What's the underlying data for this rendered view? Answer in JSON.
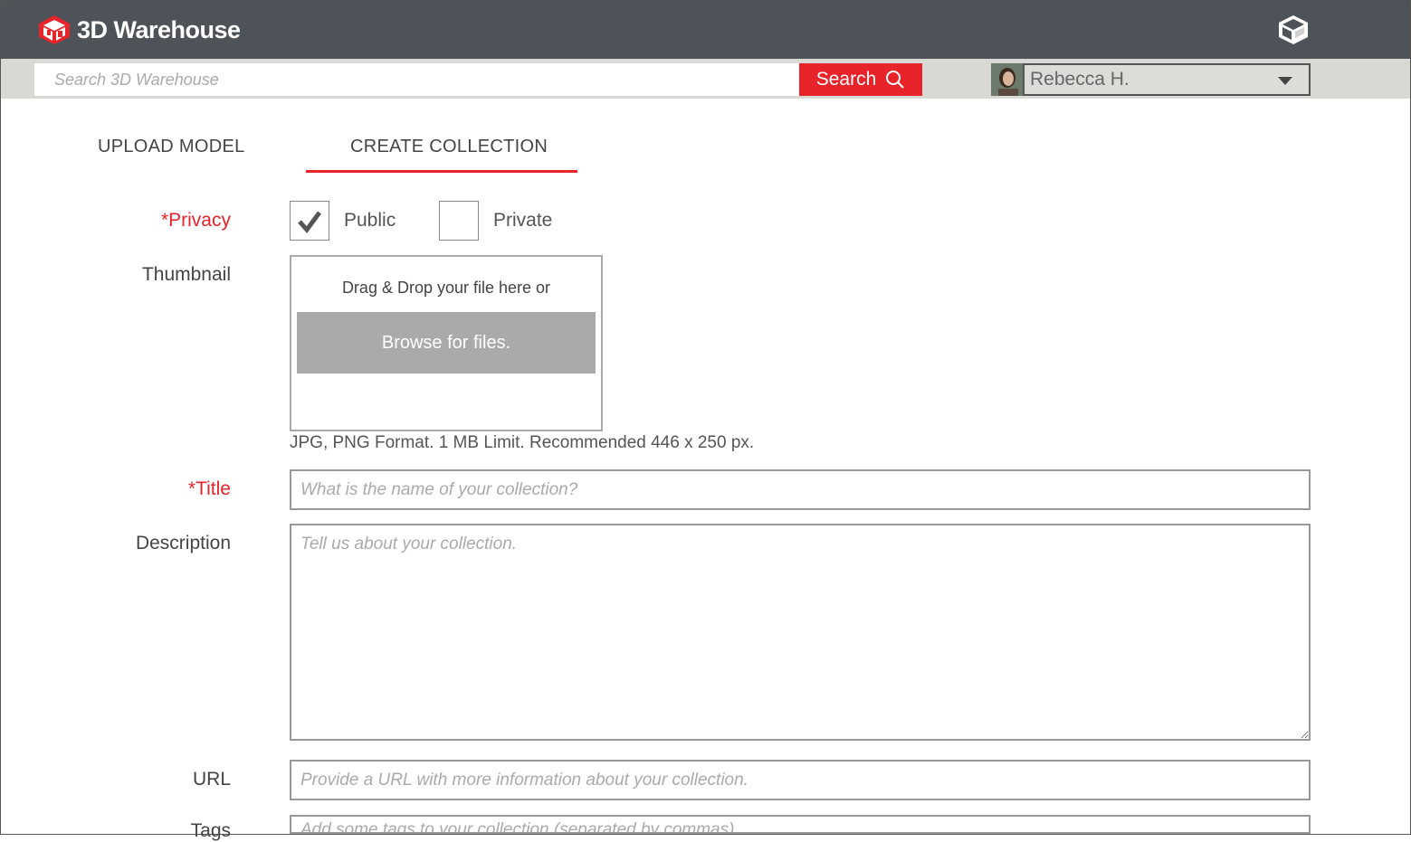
{
  "brand": {
    "name": "3D Warehouse"
  },
  "search": {
    "placeholder": "Search 3D Warehouse",
    "button_label": "Search"
  },
  "user": {
    "name": "Rebecca H."
  },
  "tabs": [
    {
      "label": "UPLOAD MODEL",
      "active": false
    },
    {
      "label": "CREATE COLLECTION",
      "active": true
    }
  ],
  "form": {
    "privacy": {
      "label": "*Privacy",
      "options": [
        {
          "label": "Public",
          "checked": true
        },
        {
          "label": "Private",
          "checked": false
        }
      ]
    },
    "thumbnail": {
      "label": "Thumbnail",
      "drop_text": "Drag & Drop your file here or",
      "browse_label": "Browse for files.",
      "hint": "JPG, PNG Format. 1 MB Limit. Recommended 446 x 250 px."
    },
    "title": {
      "label": "*Title",
      "placeholder": "What is the name of your collection?"
    },
    "description": {
      "label": "Description",
      "placeholder": "Tell us about your collection."
    },
    "url": {
      "label": "URL",
      "placeholder": "Provide a URL with more information about your collection."
    },
    "tags": {
      "label": "Tags",
      "placeholder": "Add some tags to your collection (separated by commas)."
    }
  },
  "colors": {
    "accent": "#e8232a",
    "header": "#4e5259",
    "searchbar": "#d8d8d4"
  }
}
